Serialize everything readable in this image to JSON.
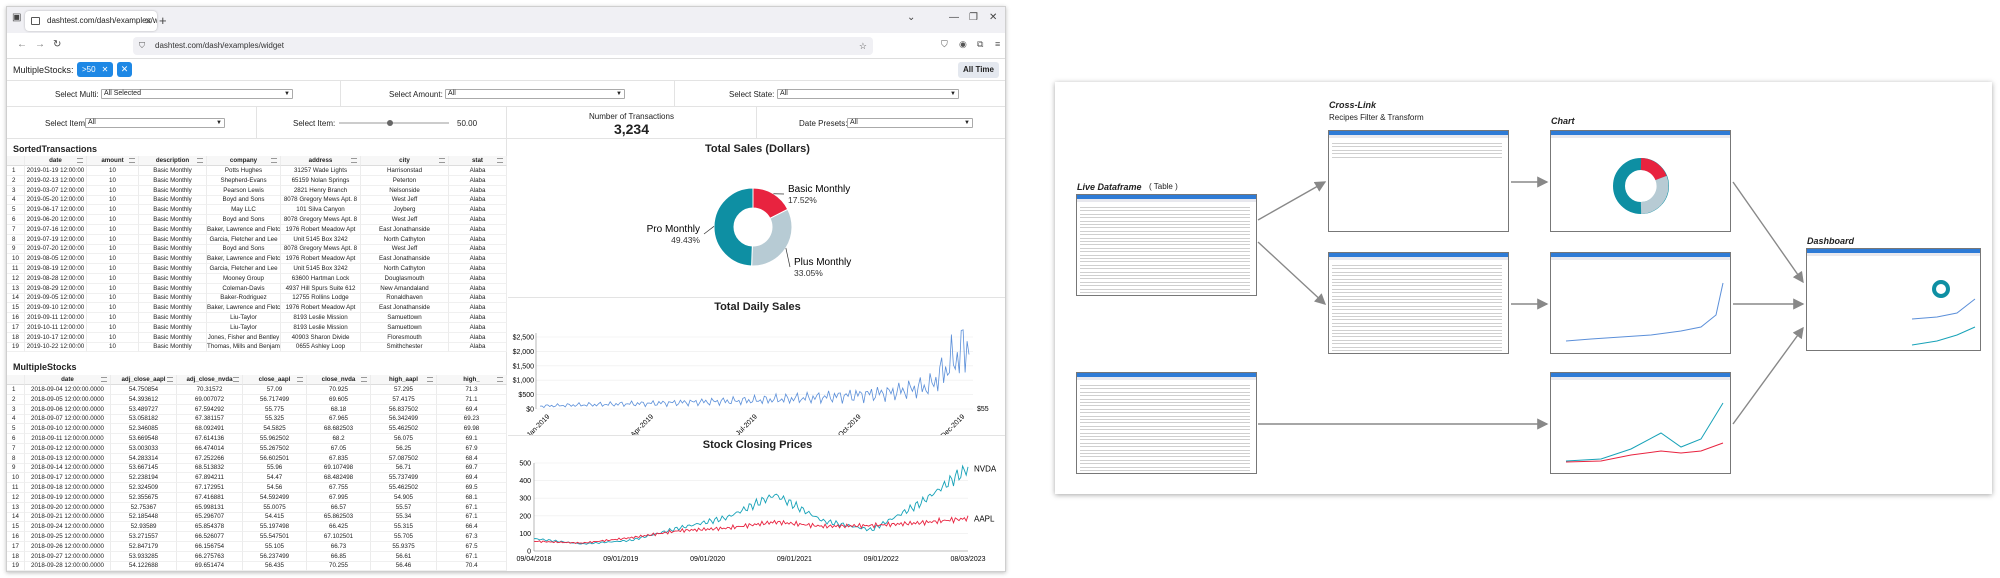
{
  "browser": {
    "tab_title": "dashtest.com/dash/examples/widget",
    "url": "dashtest.com/dash/examples/widget"
  },
  "header": {
    "multiple_stocks_label": "MultipleStocks:",
    "chip_label": ">50",
    "all_time": "All Time"
  },
  "filters": {
    "multi_label": "Select Multi:",
    "multi_value": "All Selected",
    "amount_label": "Select Amount:",
    "amount_value": "All",
    "state_label": "Select State:",
    "state_value": "All",
    "item_label": "Select Item:",
    "item_value": "All",
    "item2_label": "Select Item:",
    "item2_value": "50.00",
    "date_presets_label": "Date Presets:",
    "date_presets_value": "All"
  },
  "transactions_kpi": {
    "label": "Number of Transactions",
    "value": "3,234"
  },
  "sorted_transactions": {
    "title": "SortedTransactions",
    "columns": [
      "date",
      "amount",
      "description",
      "company",
      "address",
      "city",
      "stat"
    ],
    "rows": [
      [
        "1",
        "2019-01-19 12:00:00",
        "10",
        "Basic Monthly",
        "Potts Hughes",
        "31257 Wade Lights",
        "Harrisonstad",
        "Alaba"
      ],
      [
        "2",
        "2019-02-13 12:00:00",
        "10",
        "Basic Monthly",
        "Shepherd-Evans",
        "65159 Nolan Springs",
        "Peterton",
        "Alaba"
      ],
      [
        "3",
        "2019-03-07 12:00:00",
        "10",
        "Basic Monthly",
        "Pearson Lewis",
        "2821 Henry Branch",
        "Nelsonside",
        "Alaba"
      ],
      [
        "4",
        "2019-05-20 12:00:00",
        "10",
        "Basic Monthly",
        "Boyd and Sons",
        "8078 Gregory Mews Apt. 8",
        "West Jeff",
        "Alaba"
      ],
      [
        "5",
        "2019-06-17 12:00:00",
        "10",
        "Basic Monthly",
        "May LLC",
        "101 Silva Canyon",
        "Joyberg",
        "Alaba"
      ],
      [
        "6",
        "2019-06-20 12:00:00",
        "10",
        "Basic Monthly",
        "Boyd and Sons",
        "8078 Gregory Mews Apt. 8",
        "West Jeff",
        "Alaba"
      ],
      [
        "7",
        "2019-07-16 12:00:00",
        "10",
        "Basic Monthly",
        "Baker, Lawrence and Fletch",
        "1976 Robert Meadow Apt",
        "East Jonathanside",
        "Alaba"
      ],
      [
        "8",
        "2019-07-19 12:00:00",
        "10",
        "Basic Monthly",
        "Garcia, Fletcher and Lee",
        "Unit 5145 Box 3242",
        "North Cathyton",
        "Alaba"
      ],
      [
        "9",
        "2019-07-20 12:00:00",
        "10",
        "Basic Monthly",
        "Boyd and Sons",
        "8078 Gregory Mews Apt. 8",
        "West Jeff",
        "Alaba"
      ],
      [
        "10",
        "2019-08-05 12:00:00",
        "10",
        "Basic Monthly",
        "Baker, Lawrence and Fletch",
        "1976 Robert Meadow Apt",
        "East Jonathanside",
        "Alaba"
      ],
      [
        "11",
        "2019-08-19 12:00:00",
        "10",
        "Basic Monthly",
        "Garcia, Fletcher and Lee",
        "Unit 5145 Box 3242",
        "North Cathyton",
        "Alaba"
      ],
      [
        "12",
        "2019-08-28 12:00:00",
        "10",
        "Basic Monthly",
        "Mooney Group",
        "63600 Hartman Lock",
        "Douglasmouth",
        "Alaba"
      ],
      [
        "13",
        "2019-08-29 12:00:00",
        "10",
        "Basic Monthly",
        "Coleman-Davis",
        "4937 Hill Spurs Suite 612",
        "New Amandaland",
        "Alaba"
      ],
      [
        "14",
        "2019-09-05 12:00:00",
        "10",
        "Basic Monthly",
        "Baker-Rodriguez",
        "12755 Rollins Lodge",
        "Ronaldhaven",
        "Alaba"
      ],
      [
        "15",
        "2019-09-10 12:00:00",
        "10",
        "Basic Monthly",
        "Baker, Lawrence and Fletch",
        "1976 Robert Meadow Apt",
        "East Jonathanside",
        "Alaba"
      ],
      [
        "16",
        "2019-09-11 12:00:00",
        "10",
        "Basic Monthly",
        "Liu-Taylor",
        "8193 Leslie Mission",
        "Samuettown",
        "Alaba"
      ],
      [
        "17",
        "2019-10-11 12:00:00",
        "10",
        "Basic Monthly",
        "Liu-Taylor",
        "8193 Leslie Mission",
        "Samuettown",
        "Alaba"
      ],
      [
        "18",
        "2019-10-17 12:00:00",
        "10",
        "Basic Monthly",
        "Jones, Fisher and Bentley",
        "40903 Sharon Divide",
        "Floresmouth",
        "Alaba"
      ],
      [
        "19",
        "2019-10-22 12:00:00",
        "10",
        "Basic Monthly",
        "Thomas, Mills and Benjam",
        "0655 Ashley Loop",
        "Smithchester",
        "Alaba"
      ]
    ]
  },
  "multiple_stocks": {
    "title": "MultipleStocks",
    "columns": [
      "date",
      "adj_close_aapl",
      "adj_close_nvda",
      "close_aapl",
      "close_nvda",
      "high_aapl",
      "high_"
    ],
    "rows": [
      [
        "1",
        "2018-09-04 12:00:00.0000",
        "54.750854",
        "70.31572",
        "57.09",
        "70.925",
        "57.295",
        "71.3"
      ],
      [
        "2",
        "2018-09-05 12:00:00.0000",
        "54.393612",
        "69.007072",
        "56.717499",
        "69.605",
        "57.4175",
        "71.1"
      ],
      [
        "3",
        "2018-09-06 12:00:00.0000",
        "53.489727",
        "67.594292",
        "55.775",
        "68.18",
        "56.837502",
        "69.4"
      ],
      [
        "4",
        "2018-09-07 12:00:00.0000",
        "53.058182",
        "67.381157",
        "55.325",
        "67.965",
        "56.342499",
        "69.23"
      ],
      [
        "5",
        "2018-09-10 12:00:00.0000",
        "52.346085",
        "68.092491",
        "54.5825",
        "68.682503",
        "55.462502",
        "69.98"
      ],
      [
        "6",
        "2018-09-11 12:00:00.0000",
        "53.669548",
        "67.614136",
        "55.962502",
        "68.2",
        "56.075",
        "69.1"
      ],
      [
        "7",
        "2018-09-12 12:00:00.0000",
        "53.003033",
        "66.474014",
        "55.267502",
        "67.05",
        "56.25",
        "67.9"
      ],
      [
        "8",
        "2018-09-13 12:00:00.0000",
        "54.283314",
        "67.252266",
        "56.602501",
        "67.835",
        "57.087502",
        "68.4"
      ],
      [
        "9",
        "2018-09-14 12:00:00.0000",
        "53.667145",
        "68.513832",
        "55.96",
        "69.107498",
        "56.71",
        "69.7"
      ],
      [
        "10",
        "2018-09-17 12:00:00.0000",
        "52.238194",
        "67.894211",
        "54.47",
        "68.482498",
        "55.737499",
        "69.4"
      ],
      [
        "11",
        "2018-09-18 12:00:00.0000",
        "52.324509",
        "67.172951",
        "54.56",
        "67.755",
        "55.462502",
        "69.5"
      ],
      [
        "12",
        "2018-09-19 12:00:00.0000",
        "52.355675",
        "67.416881",
        "54.592499",
        "67.995",
        "54.905",
        "68.1"
      ],
      [
        "13",
        "2018-09-20 12:00:00.0000",
        "52.75367",
        "65.998131",
        "55.0075",
        "66.57",
        "55.57",
        "67.1"
      ],
      [
        "14",
        "2018-09-21 12:00:00.0000",
        "52.185448",
        "65.296707",
        "54.415",
        "65.862503",
        "55.34",
        "67.1"
      ],
      [
        "15",
        "2018-09-24 12:00:00.0000",
        "52.93589",
        "65.854378",
        "55.197498",
        "66.425",
        "55.315",
        "66.4"
      ],
      [
        "16",
        "2018-09-25 12:00:00.0000",
        "53.271557",
        "66.526077",
        "55.547501",
        "67.102501",
        "55.705",
        "67.3"
      ],
      [
        "17",
        "2018-09-26 12:00:00.0000",
        "52.847179",
        "66.156754",
        "55.105",
        "66.73",
        "55.9375",
        "67.5"
      ],
      [
        "18",
        "2018-09-27 12:00:00.0000",
        "53.933285",
        "66.275763",
        "56.237499",
        "66.85",
        "56.61",
        "67.1"
      ],
      [
        "19",
        "2018-09-28 12:00:00.0000",
        "54.122688",
        "69.651474",
        "56.435",
        "70.255",
        "56.46",
        "70.4"
      ]
    ]
  },
  "total_sales": {
    "title": "Total Sales (Dollars)"
  },
  "daily_sales": {
    "title": "Total Daily Sales",
    "end_label": "$55"
  },
  "stock_prices": {
    "title": "Stock Closing Prices"
  },
  "chart_data": [
    {
      "type": "pie",
      "title": "Total Sales (Dollars)",
      "slices": [
        {
          "name": "Basic Monthly",
          "value": 17.52,
          "label": "17.52%",
          "color": "#e8233f"
        },
        {
          "name": "Plus Monthly",
          "value": 33.05,
          "label": "33.05%",
          "color": "#b7cbd4"
        },
        {
          "name": "Pro Monthly",
          "value": 49.43,
          "label": "49.43%",
          "color": "#0e8fa3"
        }
      ]
    },
    {
      "type": "line",
      "title": "Total Daily Sales",
      "ylim": [
        0,
        2500
      ],
      "y_ticks": [
        "$0",
        "$500",
        "$1,000",
        "$1,500",
        "$2,000",
        "$2,500"
      ],
      "x_ticks": [
        "Jan-2019",
        "Apr-2019",
        "Jul-2019",
        "Oct-2019",
        "Dec-2019"
      ],
      "color": "#5b8fd9",
      "series": [
        {
          "x": [
            "2019-01",
            "2019-02",
            "2019-03",
            "2019-04",
            "2019-05",
            "2019-06",
            "2019-07",
            "2019-08",
            "2019-09",
            "2019-10",
            "2019-11",
            "2019-12"
          ],
          "values": [
            100,
            140,
            170,
            200,
            240,
            280,
            330,
            390,
            470,
            570,
            800,
            2300
          ]
        }
      ]
    },
    {
      "type": "line",
      "title": "Stock Closing Prices",
      "ylim": [
        0,
        500
      ],
      "y_ticks": [
        "0",
        "100",
        "200",
        "300",
        "400",
        "500"
      ],
      "x_ticks": [
        "09/04/2018",
        "09/01/2019",
        "09/01/2020",
        "09/01/2021",
        "09/01/2022",
        "08/03/2023"
      ],
      "series": [
        {
          "name": "NVDA",
          "color": "#17a2b8",
          "x": [
            "2018-09",
            "2019-06",
            "2020-01",
            "2020-09",
            "2021-06",
            "2021-11",
            "2022-06",
            "2022-10",
            "2023-03",
            "2023-08"
          ],
          "values": [
            70,
            40,
            60,
            130,
            190,
            320,
            170,
            120,
            270,
            470
          ]
        },
        {
          "name": "AAPL",
          "color": "#e8233f",
          "x": [
            "2018-09",
            "2019-06",
            "2020-01",
            "2020-09",
            "2021-06",
            "2021-11",
            "2022-06",
            "2022-10",
            "2023-03",
            "2023-08"
          ],
          "values": [
            55,
            45,
            75,
            115,
            130,
            165,
            140,
            145,
            160,
            185
          ]
        }
      ]
    }
  ],
  "diagram": {
    "live_title": "Live Dataframe",
    "live_sub": "( Table )",
    "cross_title": "Cross-Link",
    "cross_sub": "Recipes Filter & Transform",
    "chart_title": "Chart",
    "dash_title": "Dashboard"
  }
}
